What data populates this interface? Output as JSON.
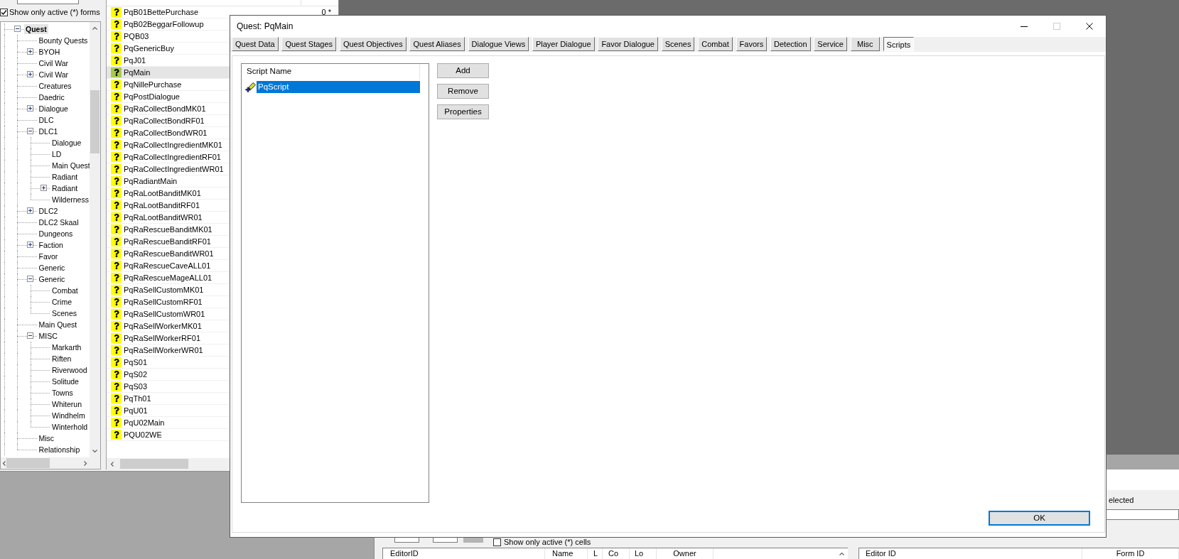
{
  "object_window": {
    "show_active_forms": {
      "label": "Show only active (*) forms",
      "checked": true
    },
    "tree": [
      {
        "label": "Quest",
        "selected": true,
        "expanded": true,
        "children": [
          {
            "label": "Bounty Quests",
            "selected": false
          },
          {
            "label": "BYOH",
            "selected": false,
            "expanded": false
          },
          {
            "label": "Civil War",
            "selected": false
          },
          {
            "label": "Civil War",
            "selected": false,
            "expanded": false
          },
          {
            "label": "Creatures",
            "selected": false
          },
          {
            "label": "Daedric",
            "selected": false
          },
          {
            "label": "Dialogue",
            "selected": false,
            "expanded": false
          },
          {
            "label": "DLC",
            "selected": false
          },
          {
            "label": "DLC1",
            "selected": false,
            "expanded": true,
            "children": [
              {
                "label": "Dialogue",
                "selected": false
              },
              {
                "label": "LD",
                "selected": false
              },
              {
                "label": "Main Quest",
                "selected": false
              },
              {
                "label": "Radiant",
                "selected": false
              },
              {
                "label": "Radiant",
                "selected": false,
                "expanded": false
              },
              {
                "label": "Wilderness",
                "selected": false
              }
            ]
          },
          {
            "label": "DLC2",
            "selected": false,
            "expanded": false
          },
          {
            "label": "DLC2 Skaal",
            "selected": false
          },
          {
            "label": "Dungeons",
            "selected": false
          },
          {
            "label": "Faction",
            "selected": false,
            "expanded": false
          },
          {
            "label": "Favor",
            "selected": false
          },
          {
            "label": "Generic",
            "selected": false
          },
          {
            "label": "Generic",
            "selected": false,
            "expanded": true,
            "children": [
              {
                "label": "Combat",
                "selected": false
              },
              {
                "label": "Crime",
                "selected": false
              },
              {
                "label": "Scenes",
                "selected": false
              }
            ]
          },
          {
            "label": "Main Quest",
            "selected": false
          },
          {
            "label": "MISC",
            "selected": false,
            "expanded": true,
            "children": [
              {
                "label": "Markarth",
                "selected": false
              },
              {
                "label": "Riften",
                "selected": false
              },
              {
                "label": "Riverwood",
                "selected": false
              },
              {
                "label": "Solitude",
                "selected": false
              },
              {
                "label": "Towns",
                "selected": false
              },
              {
                "label": "Whiterun",
                "selected": false
              },
              {
                "label": "Windhelm",
                "selected": false
              },
              {
                "label": "Winterhold",
                "selected": false
              }
            ]
          },
          {
            "label": "Misc",
            "selected": false
          },
          {
            "label": "Relationship",
            "selected": false
          }
        ]
      }
    ],
    "forms": [
      {
        "editor_id": "PqB01BettePurchase",
        "count": "0 *",
        "selected": false
      },
      {
        "editor_id": "PqB02BeggarFollowup",
        "selected": false
      },
      {
        "editor_id": "PQB03",
        "selected": false
      },
      {
        "editor_id": "PqGenericBuy",
        "selected": false
      },
      {
        "editor_id": "PqJ01",
        "selected": false
      },
      {
        "editor_id": "PqMain",
        "selected": true
      },
      {
        "editor_id": "PqNillePurchase",
        "selected": false
      },
      {
        "editor_id": "PqPostDialogue",
        "selected": false
      },
      {
        "editor_id": "PqRaCollectBondMK01",
        "selected": false
      },
      {
        "editor_id": "PqRaCollectBondRF01",
        "selected": false
      },
      {
        "editor_id": "PqRaCollectBondWR01",
        "selected": false
      },
      {
        "editor_id": "PqRaCollectIngredientMK01",
        "selected": false
      },
      {
        "editor_id": "PqRaCollectIngredientRF01",
        "selected": false
      },
      {
        "editor_id": "PqRaCollectIngredientWR01",
        "selected": false
      },
      {
        "editor_id": "PqRadiantMain",
        "selected": false
      },
      {
        "editor_id": "PqRaLootBanditMK01",
        "selected": false
      },
      {
        "editor_id": "PqRaLootBanditRF01",
        "selected": false
      },
      {
        "editor_id": "PqRaLootBanditWR01",
        "selected": false
      },
      {
        "editor_id": "PqRaRescueBanditMK01",
        "selected": false
      },
      {
        "editor_id": "PqRaRescueBanditRF01",
        "selected": false
      },
      {
        "editor_id": "PqRaRescueBanditWR01",
        "selected": false
      },
      {
        "editor_id": "PqRaRescueCaveALL01",
        "selected": false
      },
      {
        "editor_id": "PqRaRescueMageALL01",
        "selected": false
      },
      {
        "editor_id": "PqRaSellCustomMK01",
        "selected": false
      },
      {
        "editor_id": "PqRaSellCustomRF01",
        "selected": false
      },
      {
        "editor_id": "PqRaSellCustomWR01",
        "selected": false
      },
      {
        "editor_id": "PqRaSellWorkerMK01",
        "selected": false
      },
      {
        "editor_id": "PqRaSellWorkerRF01",
        "selected": false
      },
      {
        "editor_id": "PqRaSellWorkerWR01",
        "selected": false
      },
      {
        "editor_id": "PqS01",
        "selected": false
      },
      {
        "editor_id": "PqS02",
        "selected": false
      },
      {
        "editor_id": "PqS03",
        "selected": false
      },
      {
        "editor_id": "PqTh01",
        "selected": false
      },
      {
        "editor_id": "PqU01",
        "selected": false
      },
      {
        "editor_id": "PqU02Main",
        "selected": false
      },
      {
        "editor_id": "PQU02WE",
        "selected": false
      }
    ]
  },
  "quest_dialog": {
    "title": "Quest: PqMain",
    "maximize_disabled": true,
    "tabs": [
      {
        "label": "Quest Data",
        "selected": false
      },
      {
        "label": "Quest Stages",
        "selected": false
      },
      {
        "label": "Quest Objectives",
        "selected": false
      },
      {
        "label": "Quest Aliases",
        "selected": false
      },
      {
        "label": "Dialogue Views",
        "selected": false
      },
      {
        "label": "Player Dialogue",
        "selected": false
      },
      {
        "label": "Favor Dialogue",
        "selected": false
      },
      {
        "label": "Scenes",
        "selected": false
      },
      {
        "label": "Combat",
        "selected": false
      },
      {
        "label": "Favors",
        "selected": false
      },
      {
        "label": "Detection",
        "selected": false
      },
      {
        "label": "Service",
        "selected": false
      },
      {
        "label": "Misc",
        "selected": false
      },
      {
        "label": "Scripts",
        "selected": true
      }
    ],
    "scripts": {
      "column": "Script Name",
      "rows": [
        {
          "name": "PqScript",
          "selected": true
        }
      ]
    },
    "buttons": [
      "Add",
      "Remove",
      "Properties"
    ],
    "ok_button": "OK"
  },
  "cell_window": {
    "label": "elected",
    "show_active_cells": {
      "label": "Show only active (*) cells",
      "checked": false
    },
    "cells_table": {
      "columns": [
        "EditorID",
        "Name",
        "L",
        "Co",
        "Lo",
        "Owner"
      ]
    },
    "objects_table": {
      "columns": [
        "Editor ID",
        "Form ID"
      ]
    }
  }
}
